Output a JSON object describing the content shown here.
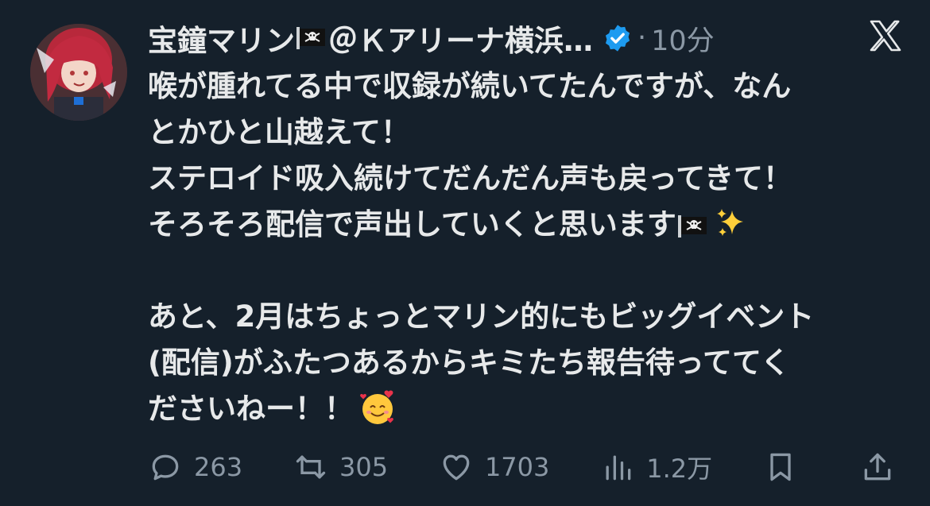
{
  "tweet": {
    "author": {
      "name_part1": "宝鐘マリン",
      "name_part2": "＠Ｋアリーナ横浜…",
      "verified": true
    },
    "time_separator": "·",
    "timestamp": "10分",
    "lines": [
      "喉が腫れてる中で収録が続いてたんですが、なん",
      "とかひと山越えて！",
      "ステロイド吸入続けてだんだん声も戻ってきて！",
      "そろそろ配信で声出していくと思います",
      "",
      "あと、2月はちょっとマリン的にもビッグイベント",
      "(配信)がふたつあるからキミたち報告待っててく",
      "ださいねー！！"
    ]
  },
  "actions": {
    "reply_count": "263",
    "retweet_count": "305",
    "like_count": "1703",
    "views_count": "1.2万"
  },
  "icons": {
    "flag": "pirate-flag-icon",
    "verified": "verified-badge-icon",
    "logo": "x-logo-icon",
    "sparkles": "sparkles-icon",
    "smiling_face_hearts": "smiling-face-with-hearts-icon"
  },
  "colors": {
    "background": "#15202b",
    "text": "#e7e9ea",
    "muted": "#8b98a5",
    "verified": "#1d9bf0"
  }
}
